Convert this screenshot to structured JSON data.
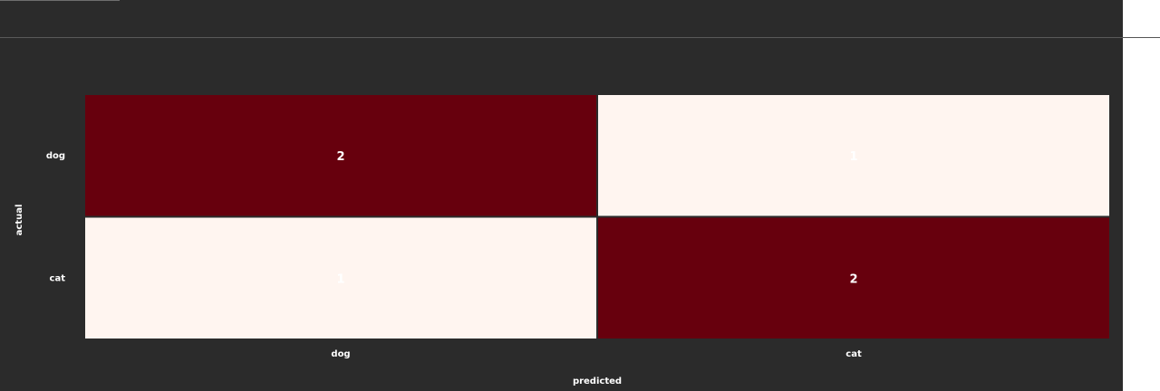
{
  "chart_data": {
    "type": "heatmap",
    "title": "",
    "xlabel": "predicted",
    "ylabel": "actual",
    "x_categories": [
      "dog",
      "cat"
    ],
    "y_categories": [
      "dog",
      "cat"
    ],
    "values": [
      [
        2,
        1
      ],
      [
        1,
        2
      ]
    ],
    "colors": {
      "high": "#67000d",
      "low": "#fff5f0",
      "background": "#2b2b2b",
      "text_on_high": "#ffffff",
      "text_on_low": "#ffffff"
    }
  }
}
